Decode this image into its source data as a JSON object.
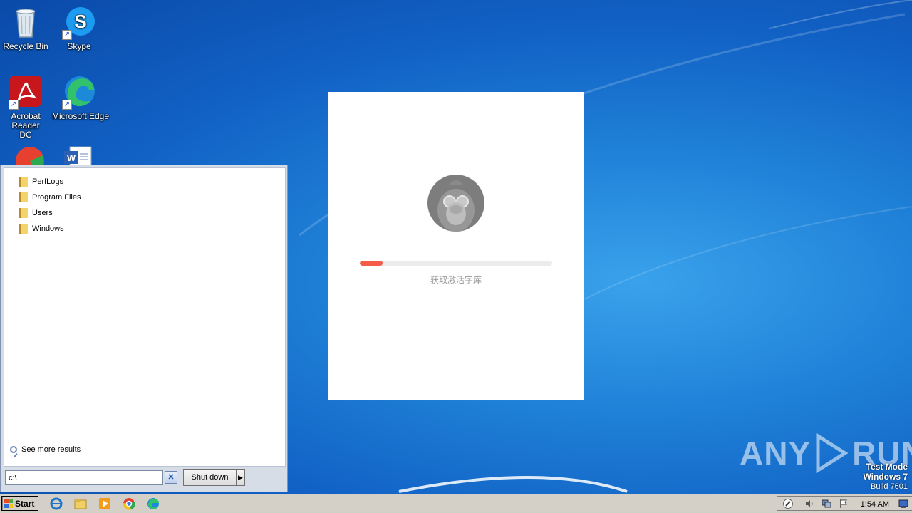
{
  "desktop": {
    "icons": [
      {
        "label": "Recycle Bin"
      },
      {
        "label": "Skype"
      },
      {
        "label": "Acrobat Reader DC"
      },
      {
        "label": "Microsoft Edge"
      }
    ]
  },
  "start_menu": {
    "folders": [
      "PerfLogs",
      "Program Files",
      "Users",
      "Windows"
    ],
    "see_more": "See more results",
    "search_value": "c:\\",
    "shutdown_label": "Shut down"
  },
  "splash": {
    "status_text": "获取激活字库",
    "progress_fraction": 0.12,
    "progress_color": "#f45b4b"
  },
  "watermark": {
    "left": "ANY",
    "right": "RUN"
  },
  "os_info": {
    "line1": "Test Mode",
    "line2": "Windows 7",
    "line3": "Build 7601"
  },
  "taskbar": {
    "start_label": "Start",
    "clock": "1:54 AM"
  }
}
